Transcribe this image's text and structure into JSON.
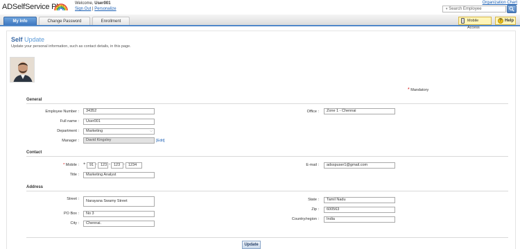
{
  "header": {
    "logo": "ADSelfService Plus",
    "welcome_prefix": "Welcome,",
    "username": "User001",
    "sign_out": "Sign Out",
    "separator": "|",
    "personalize": "Personalize",
    "org_chart": "Organization Chart",
    "search_placeholder": "Search Employee"
  },
  "tabs": [
    "My Info",
    "Change Password",
    "Enrollment"
  ],
  "toolbar": {
    "mobile_access": "Mobile Access",
    "help": "Help"
  },
  "page": {
    "title_part1": "Self",
    "title_part2": "Update",
    "description": "Update your personal information, such as contact details, in this page.",
    "mandatory": "Mandatory"
  },
  "sections": {
    "general": "General",
    "contact": "Contact",
    "address": "Address"
  },
  "fields": {
    "employee_number": {
      "label": "Employee Number :",
      "value": "34352"
    },
    "full_name": {
      "label": "Full name :",
      "value": "User001"
    },
    "department": {
      "label": "Department :",
      "value": "Marketing"
    },
    "manager": {
      "label": "Manager :",
      "value": "David Kingsley",
      "edit": "[Edit]"
    },
    "office": {
      "label": "Office :",
      "value": "Zone 1 - Chennai"
    },
    "mobile": {
      "label": "Mobile :",
      "plus": "+",
      "country": "91",
      "part1": "123",
      "part2": "123",
      "part3": "1234"
    },
    "title": {
      "label": "Title :",
      "value": "Marketing Analyst"
    },
    "email": {
      "label": "E-mail :",
      "value": "adsspuser1@gmail.com"
    },
    "street": {
      "label": "Street :",
      "value": "Narayana Swamy Street"
    },
    "po_box": {
      "label": "PO Box :",
      "value": "No 3"
    },
    "city": {
      "label": "City :",
      "value": "Chennai."
    },
    "state": {
      "label": "State :",
      "value": "Tamil Nadu"
    },
    "zip": {
      "label": "Zip :",
      "value": "600563"
    },
    "country": {
      "label": "Country/region :",
      "value": "India"
    }
  },
  "buttons": {
    "update": "Update"
  },
  "colors": {
    "accent": "#3b6aa5",
    "tab_active": "#4f87c9",
    "mandatory_star": "#d40000"
  }
}
